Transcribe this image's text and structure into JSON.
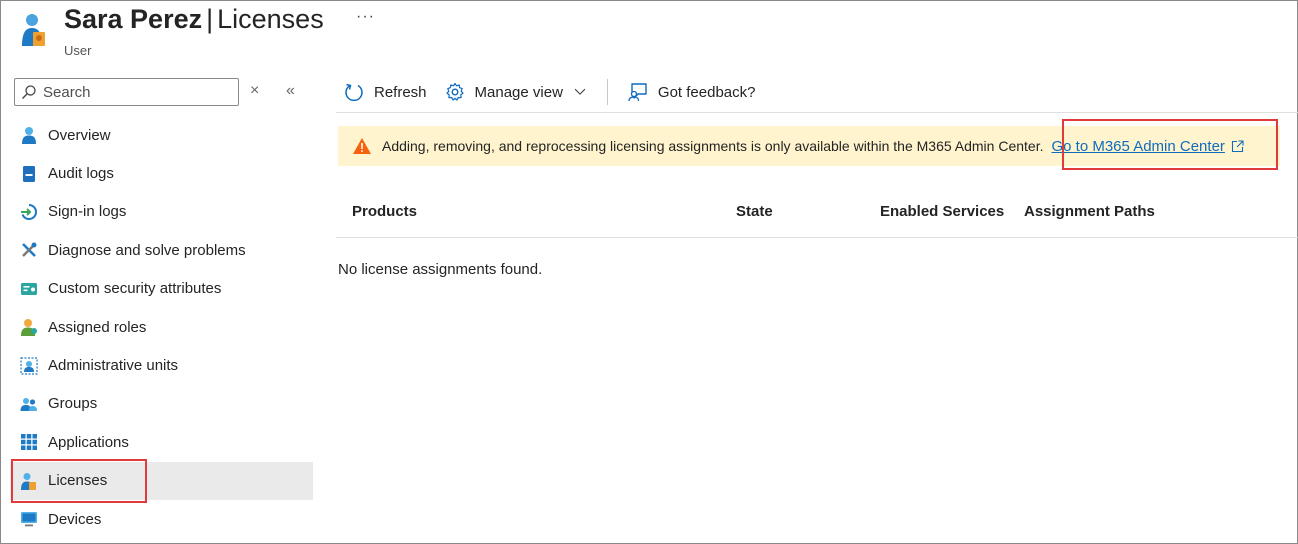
{
  "header": {
    "user_name": "Sara Perez",
    "separator": "|",
    "section": "Licenses",
    "subtitle": "User",
    "more": "···"
  },
  "sidebar": {
    "search_placeholder": "Search",
    "clear": "×",
    "collapse": "«",
    "items": [
      {
        "label": "Overview",
        "icon": "user-icon"
      },
      {
        "label": "Audit logs",
        "icon": "audit-log-icon"
      },
      {
        "label": "Sign-in logs",
        "icon": "sign-in-icon"
      },
      {
        "label": "Diagnose and solve problems",
        "icon": "wrench-icon"
      },
      {
        "label": "Custom security attributes",
        "icon": "attributes-icon"
      },
      {
        "label": "Assigned roles",
        "icon": "roles-icon"
      },
      {
        "label": "Administrative units",
        "icon": "admin-units-icon"
      },
      {
        "label": "Groups",
        "icon": "groups-icon"
      },
      {
        "label": "Applications",
        "icon": "grid-icon"
      },
      {
        "label": "Licenses",
        "icon": "license-icon",
        "active": true
      },
      {
        "label": "Devices",
        "icon": "device-icon"
      }
    ]
  },
  "toolbar": {
    "refresh": "Refresh",
    "manage_view": "Manage view",
    "feedback": "Got feedback?"
  },
  "banner": {
    "message": "Adding, removing, and reprocessing licensing assignments is only available within the M365 Admin Center.",
    "link": "Go to M365 Admin Center"
  },
  "table": {
    "columns": [
      "Products",
      "State",
      "Enabled Services",
      "Assignment Paths"
    ],
    "empty": "No license assignments found."
  },
  "colors": {
    "accent": "#0f6cbd",
    "warning_bg": "#fff4ce",
    "warning_icon": "#f7630c",
    "highlight": "#e03a3a"
  }
}
